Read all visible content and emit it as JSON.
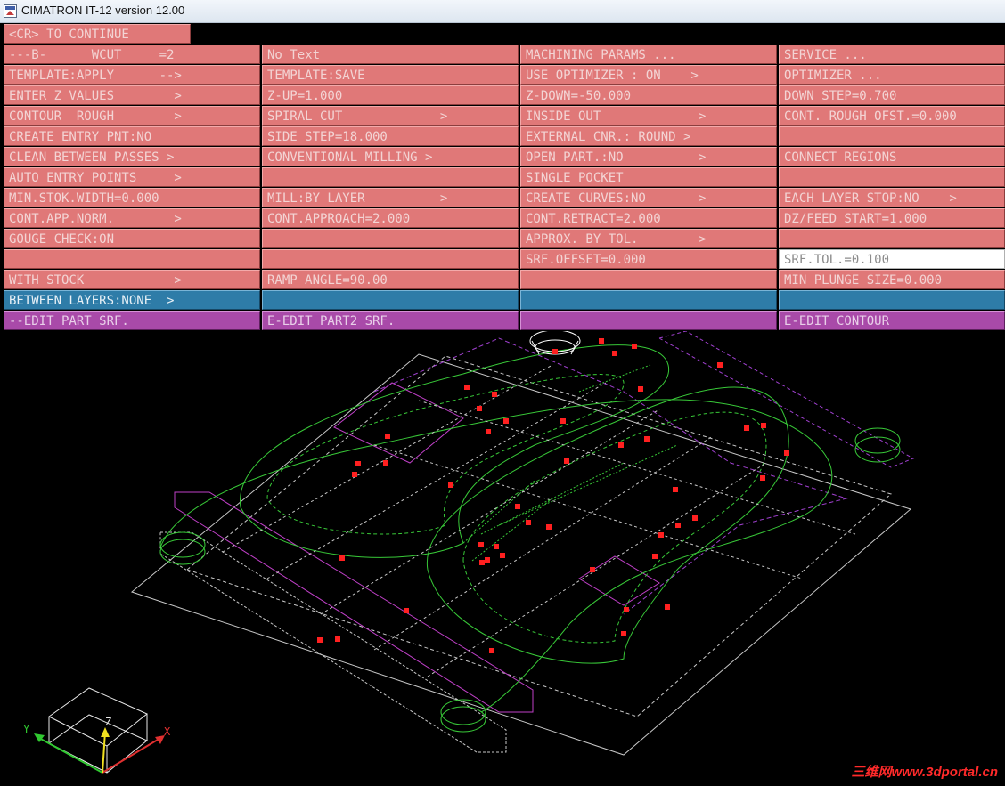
{
  "window": {
    "title": "CIMATRON IT-12 version 12.00"
  },
  "continue_label": "<CR> TO CONTINUE",
  "rows": [
    [
      "---B-      WCUT     =2",
      "No Text",
      "MACHINING PARAMS ...",
      "SERVICE ..."
    ],
    [
      "TEMPLATE:APPLY      -->",
      "TEMPLATE:SAVE",
      "USE OPTIMIZER : ON    >",
      "OPTIMIZER ..."
    ],
    [
      "ENTER Z VALUES        >",
      "Z-UP=1.000",
      "Z-DOWN=-50.000",
      "DOWN STEP=0.700"
    ],
    [
      "CONTOUR  ROUGH        >",
      "SPIRAL CUT             >",
      "INSIDE OUT             >",
      "CONT. ROUGH OFST.=0.000"
    ],
    [
      "CREATE ENTRY PNT:NO",
      "SIDE STEP=18.000",
      "EXTERNAL CNR.: ROUND >",
      ""
    ],
    [
      "CLEAN BETWEEN PASSES >",
      "CONVENTIONAL MILLING >",
      "OPEN PART.:NO          >",
      "CONNECT REGIONS"
    ],
    [
      "AUTO ENTRY POINTS     >",
      "",
      "SINGLE POCKET",
      ""
    ],
    [
      "MIN.STOK.WIDTH=0.000",
      "MILL:BY LAYER          >",
      "CREATE CURVES:NO       >",
      "EACH LAYER STOP:NO    >"
    ],
    [
      "CONT.APP.NORM.        >",
      "CONT.APPROACH=2.000",
      "CONT.RETRACT=2.000",
      "DZ/FEED START=1.000"
    ],
    [
      "GOUGE CHECK:ON",
      "",
      "APPROX. BY TOL.        >",
      ""
    ],
    [
      "",
      "",
      "SRF.OFFSET=0.000",
      "SRF.TOL.=0.100"
    ],
    [
      "WITH STOCK            >",
      "RAMP ANGLE=90.00",
      "",
      "MIN PLUNGE SIZE=0.000"
    ],
    [
      "BETWEEN LAYERS:NONE  >",
      "",
      "",
      ""
    ],
    [
      "--EDIT PART SRF.",
      "E-EDIT PART2 SRF.",
      "",
      "E-EDIT CONTOUR"
    ]
  ],
  "axes": {
    "x": "X",
    "y": "Y",
    "z": "Z"
  },
  "watermark": "三维网www.3dportal.cn",
  "colors": {
    "menu": "#e07878",
    "menu_blue": "#2e7ca8",
    "menu_purple": "#a94aa9",
    "wire_green": "#38c838",
    "wire_purple": "#a040d0",
    "marker_red": "#ff2020"
  }
}
